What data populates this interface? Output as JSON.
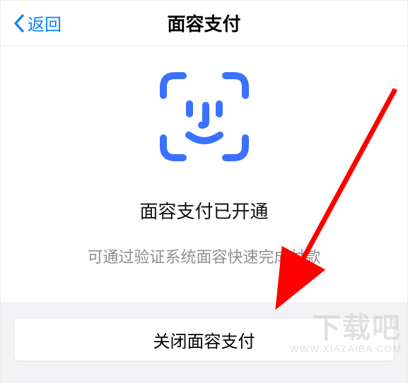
{
  "header": {
    "back_label": "返回",
    "title": "面容支付"
  },
  "main": {
    "status": "面容支付已开通",
    "description": "可通过验证系统面容快速完成付款"
  },
  "footer": {
    "disable_label": "关闭面容支付"
  },
  "icons": {
    "back": "chevron-left",
    "face": "face-id-icon"
  },
  "colors": {
    "accent": "#3a72ff",
    "link": "#0a84ff",
    "text_secondary": "#8f8f92",
    "footer_bg": "#f3f3f5",
    "annotation_arrow": "#ff0000"
  },
  "watermark": {
    "text_main": "下载吧",
    "text_url": "WWW.XIAZAIBA.COM"
  }
}
